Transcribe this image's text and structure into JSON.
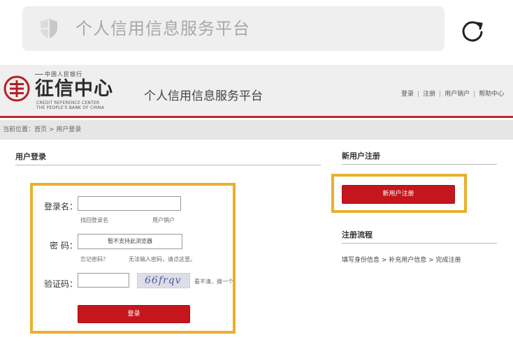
{
  "browser": {
    "address_text": "个人信用信息服务平台"
  },
  "header": {
    "logo_top": "中国人民银行",
    "logo_name": "征信中心",
    "logo_en_line1": "CREDIT REFERENCE CENTER",
    "logo_en_line2": "THE PEOPLE'S BANK OF CHINA",
    "site_title": "个人信用信息服务平台",
    "links": [
      "登录",
      "注册",
      "用户销户",
      "帮助中心"
    ]
  },
  "breadcrumb": {
    "text": "当前位置：首页 > 用户登录"
  },
  "login": {
    "section_title": "用户登录",
    "username_label": "登录名：",
    "username_value": "",
    "find_username": "找回登录名",
    "cancel_account": "用户销户",
    "password_label": "密  码：",
    "password_placeholder": "暂不支持此浏览器",
    "forgot_password": "忘记密码？",
    "cannot_input": "无法输入密码，请点这里。",
    "captcha_label": "验证码：",
    "captcha_value": "",
    "captcha_image_text": "66frqv",
    "refresh_captcha": "看不清，换一个",
    "submit_label": "登录"
  },
  "register": {
    "section_title": "新用户注册",
    "button_label": "新用户注册",
    "flow_title": "注册流程",
    "flow_steps": "填写身份信息 > 补充用户信息 > 完成注册"
  },
  "colors": {
    "brand_red": "#c4161c",
    "highlight_gold": "#e9b02b"
  }
}
